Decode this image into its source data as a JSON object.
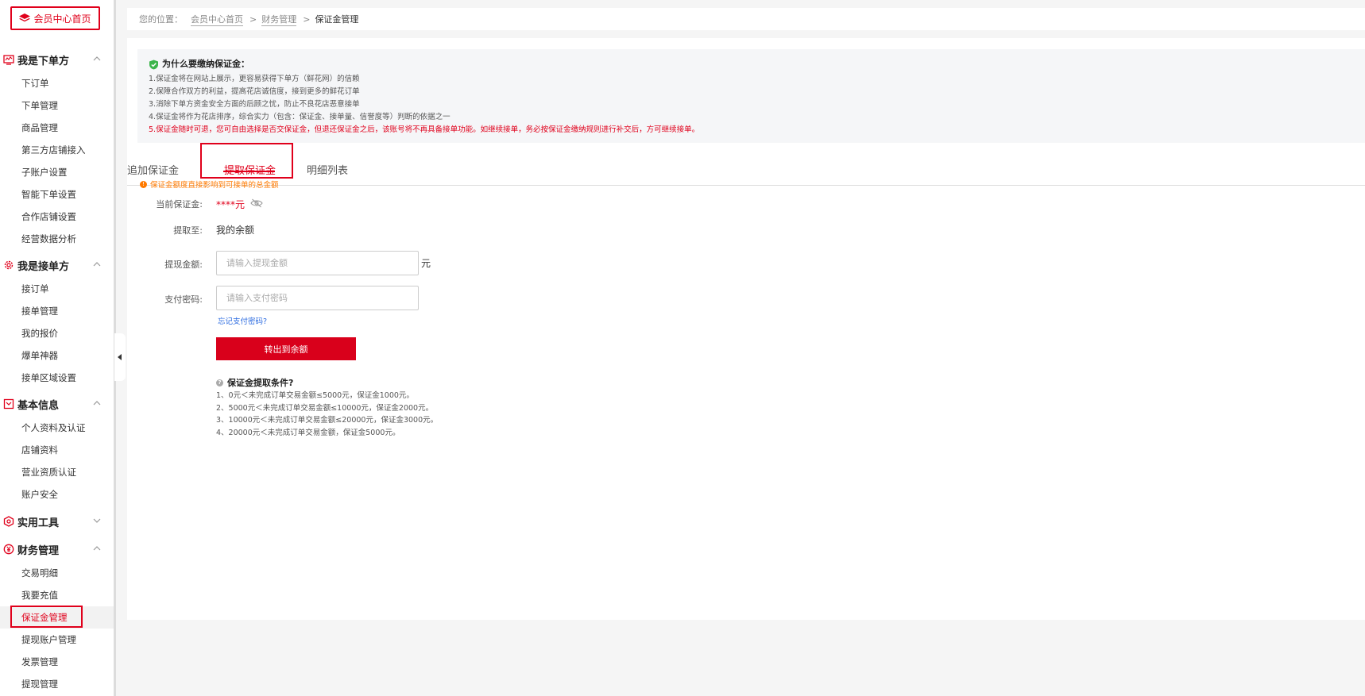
{
  "sidebar": {
    "home_label": "会员中心首页",
    "sections": {
      "buyer": {
        "title": "我是下单方",
        "items": [
          "下订单",
          "下单管理",
          "商品管理",
          "第三方店铺接入",
          "子账户设置",
          "智能下单设置",
          "合作店铺设置",
          "经营数据分析"
        ]
      },
      "seller": {
        "title": "我是接单方",
        "items": [
          "接订单",
          "接单管理",
          "我的报价",
          "爆单神器",
          "接单区域设置"
        ]
      },
      "basic": {
        "title": "基本信息",
        "items": [
          "个人资料及认证",
          "店铺资料",
          "营业资质认证",
          "账户安全"
        ]
      },
      "tools": {
        "title": "实用工具"
      },
      "finance": {
        "title": "财务管理",
        "items": [
          "交易明细",
          "我要充值",
          "保证金管理",
          "提现账户管理",
          "发票管理",
          "提现管理"
        ]
      }
    },
    "active_item": "保证金管理"
  },
  "breadcrumb": {
    "prefix": "您的位置：",
    "items": [
      "会员中心首页",
      "财务管理"
    ],
    "current": "保证金管理"
  },
  "notice": {
    "title": "为什么要缴纳保证金：",
    "lines": [
      "1.保证金将在网站上展示，更容易获得下单方（鲜花网）的信赖",
      "2.保障合作双方的利益，提高花店诚信度，接到更多的鲜花订单",
      "3.消除下单方资金安全方面的后顾之忧，防止不良花店恶意接单",
      "4.保证金将作为花店排序，综合实力（包含：保证金、接单量、信誉度等）判断的依据之一"
    ],
    "warning": "5.保证金随时可退，您可自由选择是否交保证金，但退还保证金之后，该账号将不再具备接单功能。如继续接单，务必按保证金缴纳规则进行补交后，方可继续接单。"
  },
  "tabs": [
    "追加保证金",
    "提取保证金",
    "明细列表"
  ],
  "active_tab": "提取保证金",
  "tip": "保证金额度直接影响到可接单的总金额",
  "form": {
    "deposit_label": "当前保证金:",
    "deposit_value": "****元",
    "withdraw_to_label": "提取至:",
    "withdraw_to_value": "我的余额",
    "amount_label": "提现金额:",
    "amount_placeholder": "请输入提现金额",
    "amount_unit": "元",
    "password_label": "支付密码:",
    "password_placeholder": "请输入支付密码",
    "forgot_link": "忘记支付密码?",
    "submit_label": "转出到余额"
  },
  "conditions": {
    "title": "保证金提取条件?",
    "lines": [
      "1、0元＜未完成订单交易金额≤5000元，保证金1000元。",
      "2、5000元＜未完成订单交易金额≤10000元，保证金2000元。",
      "3、10000元＜未完成订单交易金额≤20000元，保证金3000元。",
      "4、20000元＜未完成订单交易金额，保证金5000元。"
    ]
  },
  "colors": {
    "accent": "#e0001b",
    "tip": "#ff7a00",
    "link": "#2a6ae0"
  }
}
